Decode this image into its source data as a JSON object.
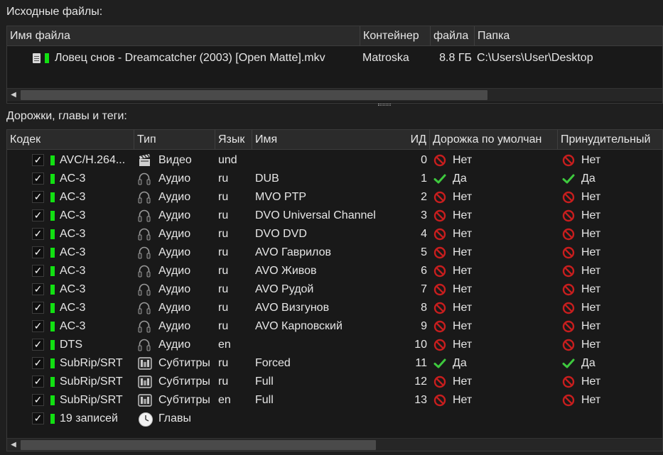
{
  "source_files": {
    "title": "Исходные файлы:",
    "columns": [
      "Имя файла",
      "Контейнер",
      "файла",
      "Папка"
    ],
    "rows": [
      {
        "name": "Ловец снов - Dreamcatcher (2003) [Open Matte].mkv",
        "container": "Matroska",
        "size": "8.8 ГБ",
        "folder": "C:\\Users\\User\\Desktop"
      }
    ]
  },
  "tracks": {
    "title": "Дорожки, главы и теги:",
    "columns": [
      "Кодек",
      "Тип",
      "Язык",
      "Имя",
      "ИД",
      "Дорожка по умолчан",
      "Принудительный"
    ],
    "rows": [
      {
        "codec": "AVC/H.264...",
        "type": "Видео",
        "type_icon": "video-clapper-icon",
        "lang": "und",
        "name": "",
        "id": "0",
        "default": "Нет",
        "default_icon": "no-icon",
        "forced": "Нет",
        "forced_icon": "no-icon"
      },
      {
        "codec": "AC-3",
        "type": "Аудио",
        "type_icon": "headphones-icon",
        "lang": "ru",
        "name": "DUB",
        "id": "1",
        "default": "Да",
        "default_icon": "check-icon",
        "forced": "Да",
        "forced_icon": "check-icon"
      },
      {
        "codec": "AC-3",
        "type": "Аудио",
        "type_icon": "headphones-icon",
        "lang": "ru",
        "name": "MVO PTP",
        "id": "2",
        "default": "Нет",
        "default_icon": "no-icon",
        "forced": "Нет",
        "forced_icon": "no-icon"
      },
      {
        "codec": "AC-3",
        "type": "Аудио",
        "type_icon": "headphones-icon",
        "lang": "ru",
        "name": "DVO Universal Channel",
        "id": "3",
        "default": "Нет",
        "default_icon": "no-icon",
        "forced": "Нет",
        "forced_icon": "no-icon"
      },
      {
        "codec": "AC-3",
        "type": "Аудио",
        "type_icon": "headphones-icon",
        "lang": "ru",
        "name": "DVO DVD",
        "id": "4",
        "default": "Нет",
        "default_icon": "no-icon",
        "forced": "Нет",
        "forced_icon": "no-icon"
      },
      {
        "codec": "AC-3",
        "type": "Аудио",
        "type_icon": "headphones-icon",
        "lang": "ru",
        "name": "AVO Гаврилов",
        "id": "5",
        "default": "Нет",
        "default_icon": "no-icon",
        "forced": "Нет",
        "forced_icon": "no-icon"
      },
      {
        "codec": "AC-3",
        "type": "Аудио",
        "type_icon": "headphones-icon",
        "lang": "ru",
        "name": "AVO Живов",
        "id": "6",
        "default": "Нет",
        "default_icon": "no-icon",
        "forced": "Нет",
        "forced_icon": "no-icon"
      },
      {
        "codec": "AC-3",
        "type": "Аудио",
        "type_icon": "headphones-icon",
        "lang": "ru",
        "name": "AVO Рудой",
        "id": "7",
        "default": "Нет",
        "default_icon": "no-icon",
        "forced": "Нет",
        "forced_icon": "no-icon"
      },
      {
        "codec": "AC-3",
        "type": "Аудио",
        "type_icon": "headphones-icon",
        "lang": "ru",
        "name": "AVO Визгунов",
        "id": "8",
        "default": "Нет",
        "default_icon": "no-icon",
        "forced": "Нет",
        "forced_icon": "no-icon"
      },
      {
        "codec": "AC-3",
        "type": "Аудио",
        "type_icon": "headphones-icon",
        "lang": "ru",
        "name": "AVO Карповский",
        "id": "9",
        "default": "Нет",
        "default_icon": "no-icon",
        "forced": "Нет",
        "forced_icon": "no-icon"
      },
      {
        "codec": "DTS",
        "type": "Аудио",
        "type_icon": "headphones-icon",
        "lang": "en",
        "name": "",
        "id": "10",
        "default": "Нет",
        "default_icon": "no-icon",
        "forced": "Нет",
        "forced_icon": "no-icon"
      },
      {
        "codec": "SubRip/SRT",
        "type": "Субтитры",
        "type_icon": "subtitles-icon",
        "lang": "ru",
        "name": "Forced",
        "id": "11",
        "default": "Да",
        "default_icon": "check-icon",
        "forced": "Да",
        "forced_icon": "check-icon"
      },
      {
        "codec": "SubRip/SRT",
        "type": "Субтитры",
        "type_icon": "subtitles-icon",
        "lang": "ru",
        "name": "Full",
        "id": "12",
        "default": "Нет",
        "default_icon": "no-icon",
        "forced": "Нет",
        "forced_icon": "no-icon"
      },
      {
        "codec": "SubRip/SRT",
        "type": "Субтитры",
        "type_icon": "subtitles-icon",
        "lang": "en",
        "name": "Full",
        "id": "13",
        "default": "Нет",
        "default_icon": "no-icon",
        "forced": "Нет",
        "forced_icon": "no-icon"
      },
      {
        "codec": "19 записей",
        "type": "Главы",
        "type_icon": "clock-icon",
        "lang": "",
        "name": "",
        "id": "",
        "default": "",
        "default_icon": "",
        "forced": "",
        "forced_icon": ""
      }
    ]
  },
  "colors": {
    "bg": "#1f1f1f",
    "panel": "#191919",
    "header": "#2b2b2b",
    "enabled_marker": "#12e012",
    "no": "#c81e1e",
    "yes": "#3ec93e"
  }
}
